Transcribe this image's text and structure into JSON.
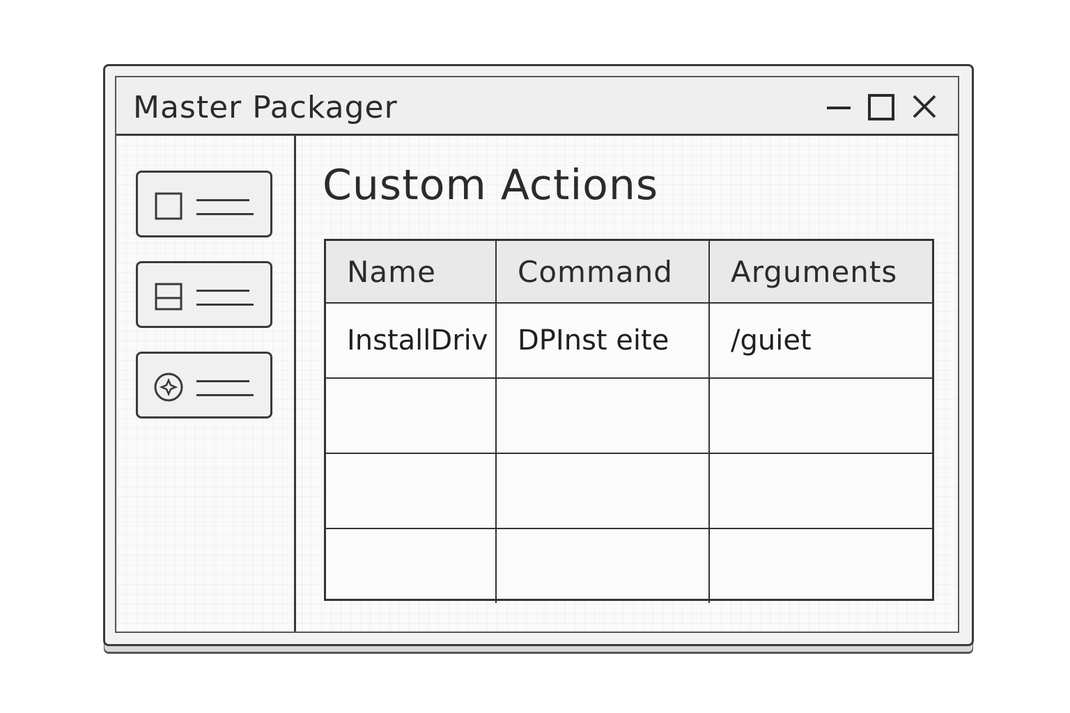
{
  "window": {
    "title": "Master Packager"
  },
  "sidebar": {
    "items": [
      {
        "icon": "checkbox-icon"
      },
      {
        "icon": "split-box-icon"
      },
      {
        "icon": "gear-circle-icon"
      }
    ]
  },
  "main": {
    "title": "Custom Actions",
    "table": {
      "columns": [
        "Name",
        "Command",
        "Arguments"
      ],
      "rows": [
        [
          "InstallDriv",
          "DPInst eite",
          "/guiet"
        ],
        [
          "",
          "",
          ""
        ],
        [
          "",
          "",
          ""
        ],
        [
          "",
          "",
          ""
        ]
      ]
    }
  }
}
